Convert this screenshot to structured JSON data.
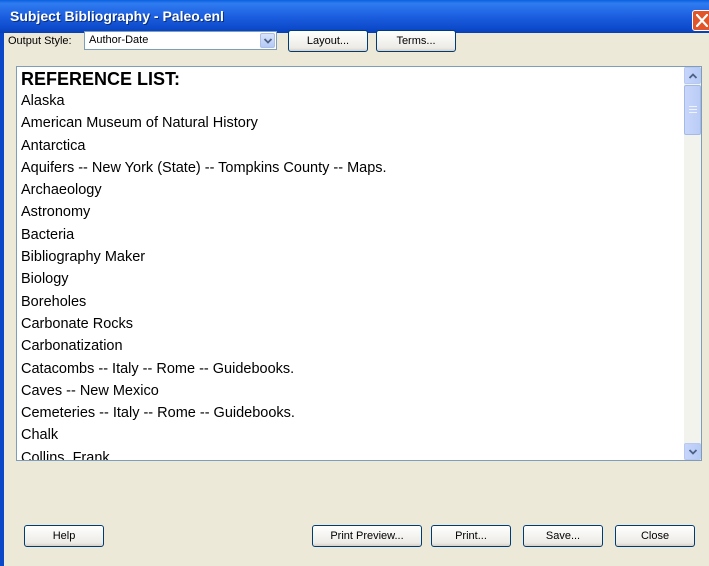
{
  "window": {
    "title": "Subject Bibliography - Paleo.enl"
  },
  "toolbar": {
    "output_style_label": "Output Style:",
    "output_style_value": "Author-Date",
    "layout_label": "Layout...",
    "terms_label": "Terms..."
  },
  "list": {
    "heading": "REFERENCE LIST:",
    "items": [
      "Alaska",
      "American Museum of Natural History",
      "Antarctica",
      "Aquifers -- New York (State) -- Tompkins County -- Maps.",
      "Archaeology",
      "Astronomy",
      "Bacteria",
      "Bibliography Maker",
      "Biology",
      "Boreholes",
      "Carbonate Rocks",
      "Carbonatization",
      "Catacombs -- Italy -- Rome -- Guidebooks.",
      "Caves -- New Mexico",
      "Cemeteries -- Italy -- Rome -- Guidebooks.",
      "Chalk",
      "Collins, Frank"
    ]
  },
  "footer": {
    "help_label": "Help",
    "print_preview_label": "Print Preview...",
    "print_label": "Print...",
    "save_label": "Save...",
    "close_label": "Close"
  }
}
